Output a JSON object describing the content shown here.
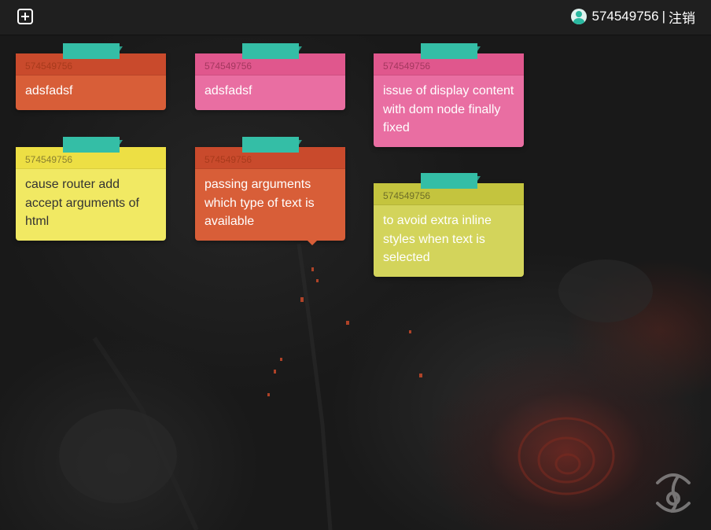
{
  "app": {
    "user_id": "574549756",
    "separator": "|",
    "logout_label": "注销"
  },
  "notes": [
    {
      "header": "574549756",
      "text": "adsfadsf",
      "color": "orange"
    },
    {
      "header": "574549756",
      "text": "adsfadsf",
      "color": "pink"
    },
    {
      "header": "574549756",
      "text": "issue of display content with dom node finally fixed",
      "color": "pink"
    },
    {
      "header": "574549756",
      "text": "cause router add accept arguments of html",
      "color": "yellow"
    },
    {
      "header": "574549756",
      "text": "passing arguments which type of text is available",
      "color": "orange"
    },
    {
      "header": "574549756",
      "text": "to avoid extra inline styles when text is selected",
      "color": "olive"
    }
  ],
  "colors": {
    "orange": "#d85e38",
    "pink": "#e96ea2",
    "yellow": "#f1e963",
    "olive": "#d3d45b",
    "tab": "#34bea6",
    "topbar": "#1f1f1f"
  },
  "icons": {
    "add": "add-note-icon",
    "avatar": "user-avatar-icon",
    "watermark": "logo-watermark-icon"
  }
}
